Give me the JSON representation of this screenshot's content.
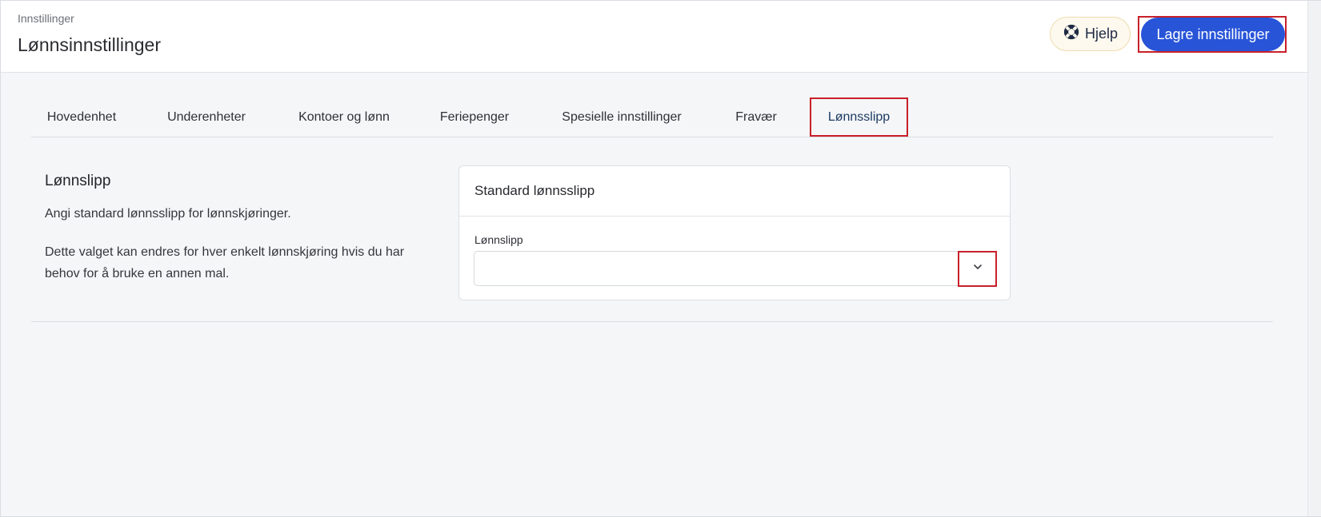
{
  "header": {
    "breadcrumb": "Innstillinger",
    "title": "Lønnsinnstillinger",
    "help_label": "Hjelp",
    "save_label": "Lagre innstillinger"
  },
  "tabs": [
    {
      "label": "Hovedenhet",
      "active": false
    },
    {
      "label": "Underenheter",
      "active": false
    },
    {
      "label": "Kontoer og lønn",
      "active": false
    },
    {
      "label": "Feriepenger",
      "active": false
    },
    {
      "label": "Spesielle innstillinger",
      "active": false
    },
    {
      "label": "Fravær",
      "active": false
    },
    {
      "label": "Lønnsslipp",
      "active": true
    }
  ],
  "section": {
    "title": "Lønnslipp",
    "description": "Angi standard lønnsslipp for lønnskjøringer.",
    "note": "Dette valget kan endres for hver enkelt lønnskjøring hvis du har behov for å bruke en annen mal."
  },
  "card": {
    "title": "Standard lønnsslipp",
    "field_label": "Lønnslipp",
    "selected_value": ""
  },
  "icons": {
    "help": "lifebuoy-icon",
    "dropdown": "chevron-down-icon"
  },
  "colors": {
    "primary": "#2854d8",
    "highlight": "#c8202a",
    "help_bg": "#fdf9ee"
  }
}
